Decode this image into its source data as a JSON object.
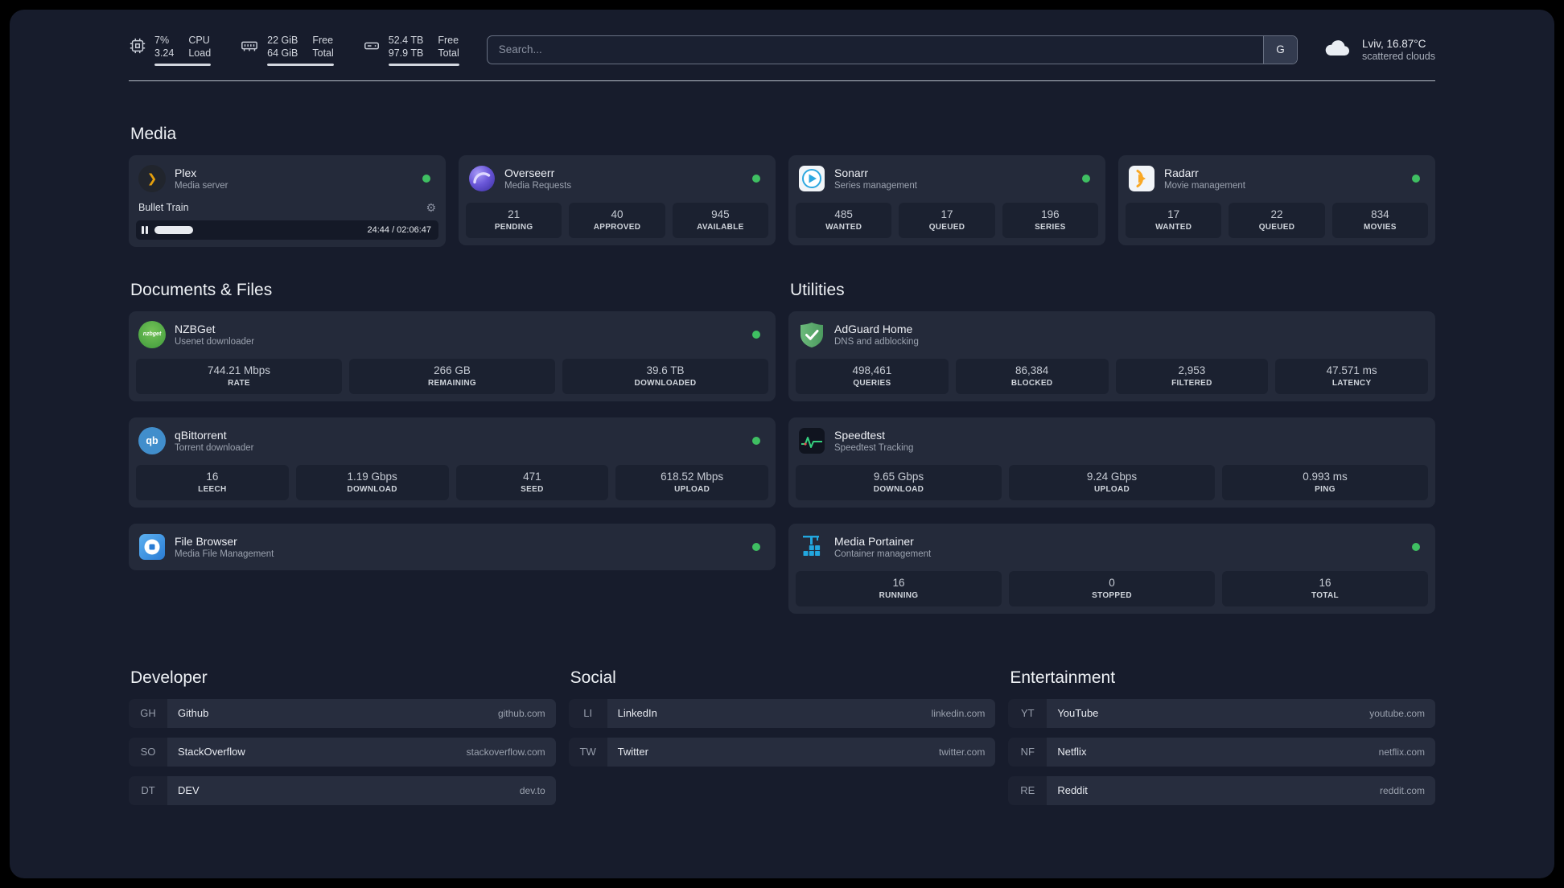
{
  "icons": {
    "plex_chevron": "❯",
    "gear": "⚙",
    "nzbget_text": "nzbget",
    "qbittorrent_text": "qb"
  },
  "topbar": {
    "cpu": {
      "value1": "7%",
      "value2": "3.24",
      "label1": "CPU",
      "label2": "Load"
    },
    "memory": {
      "value1": "22 GiB",
      "value2": "64 GiB",
      "label1": "Free",
      "label2": "Total"
    },
    "disk": {
      "value1": "52.4 TB",
      "value2": "97.9 TB",
      "label1": "Free",
      "label2": "Total"
    },
    "search": {
      "placeholder": "Search...",
      "button_label": "G"
    },
    "weather": {
      "location": "Lviv, 16.87°C",
      "condition": "scattered clouds"
    }
  },
  "sections": {
    "media": "Media",
    "documents": "Documents & Files",
    "utilities": "Utilities"
  },
  "services": {
    "plex": {
      "name": "Plex",
      "subtitle": "Media server",
      "now_playing": "Bullet Train",
      "time": "24:44 / 02:06:47"
    },
    "overseerr": {
      "name": "Overseerr",
      "subtitle": "Media Requests",
      "stats": [
        {
          "value": "21",
          "label": "PENDING"
        },
        {
          "value": "40",
          "label": "APPROVED"
        },
        {
          "value": "945",
          "label": "AVAILABLE"
        }
      ]
    },
    "sonarr": {
      "name": "Sonarr",
      "subtitle": "Series management",
      "stats": [
        {
          "value": "485",
          "label": "WANTED"
        },
        {
          "value": "17",
          "label": "QUEUED"
        },
        {
          "value": "196",
          "label": "SERIES"
        }
      ]
    },
    "radarr": {
      "name": "Radarr",
      "subtitle": "Movie management",
      "stats": [
        {
          "value": "17",
          "label": "WANTED"
        },
        {
          "value": "22",
          "label": "QUEUED"
        },
        {
          "value": "834",
          "label": "MOVIES"
        }
      ]
    },
    "nzbget": {
      "name": "NZBGet",
      "subtitle": "Usenet downloader",
      "stats": [
        {
          "value": "744.21 Mbps",
          "label": "RATE"
        },
        {
          "value": "266 GB",
          "label": "REMAINING"
        },
        {
          "value": "39.6 TB",
          "label": "DOWNLOADED"
        }
      ]
    },
    "qbittorrent": {
      "name": "qBittorrent",
      "subtitle": "Torrent downloader",
      "stats": [
        {
          "value": "16",
          "label": "LEECH"
        },
        {
          "value": "1.19 Gbps",
          "label": "DOWNLOAD"
        },
        {
          "value": "471",
          "label": "SEED"
        },
        {
          "value": "618.52 Mbps",
          "label": "UPLOAD"
        }
      ]
    },
    "filebrowser": {
      "name": "File Browser",
      "subtitle": "Media File Management"
    },
    "adguard": {
      "name": "AdGuard Home",
      "subtitle": "DNS and adblocking",
      "stats": [
        {
          "value": "498,461",
          "label": "QUERIES"
        },
        {
          "value": "86,384",
          "label": "BLOCKED"
        },
        {
          "value": "2,953",
          "label": "FILTERED"
        },
        {
          "value": "47.571 ms",
          "label": "LATENCY"
        }
      ]
    },
    "speedtest": {
      "name": "Speedtest",
      "subtitle": "Speedtest Tracking",
      "stats": [
        {
          "value": "9.65 Gbps",
          "label": "DOWNLOAD"
        },
        {
          "value": "9.24 Gbps",
          "label": "UPLOAD"
        },
        {
          "value": "0.993 ms",
          "label": "PING"
        }
      ]
    },
    "portainer": {
      "name": "Media Portainer",
      "subtitle": "Container management",
      "stats": [
        {
          "value": "16",
          "label": "RUNNING"
        },
        {
          "value": "0",
          "label": "STOPPED"
        },
        {
          "value": "16",
          "label": "TOTAL"
        }
      ]
    }
  },
  "bookmarks": {
    "developer": {
      "title": "Developer",
      "items": [
        {
          "abbr": "GH",
          "name": "Github",
          "domain": "github.com"
        },
        {
          "abbr": "SO",
          "name": "StackOverflow",
          "domain": "stackoverflow.com"
        },
        {
          "abbr": "DT",
          "name": "DEV",
          "domain": "dev.to"
        }
      ]
    },
    "social": {
      "title": "Social",
      "items": [
        {
          "abbr": "LI",
          "name": "LinkedIn",
          "domain": "linkedin.com"
        },
        {
          "abbr": "TW",
          "name": "Twitter",
          "domain": "twitter.com"
        }
      ]
    },
    "entertainment": {
      "title": "Entertainment",
      "items": [
        {
          "abbr": "YT",
          "name": "YouTube",
          "domain": "youtube.com"
        },
        {
          "abbr": "NF",
          "name": "Netflix",
          "domain": "netflix.com"
        },
        {
          "abbr": "RE",
          "name": "Reddit",
          "domain": "reddit.com"
        }
      ]
    }
  }
}
